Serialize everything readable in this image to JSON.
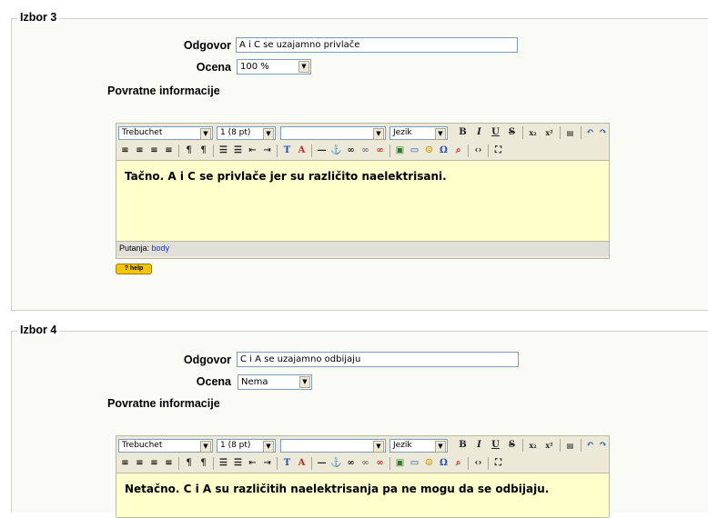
{
  "choice3": {
    "legend": "Izbor 3",
    "answer_label": "Odgovor",
    "answer_value": "A i C se uzajamno privlače",
    "grade_label": "Ocena",
    "grade_value": "100 %",
    "feedback_label": "Povratne informacije",
    "editor": {
      "font": "Trebuchet",
      "size": "1 (8 pt)",
      "style": "",
      "lang": "Jezik",
      "content": "Tačno. A i C se privlače jer su različito naelektrisani.",
      "path_label": "Putanja:",
      "path_value": "body",
      "help": "? help"
    }
  },
  "choice4": {
    "legend": "Izbor 4",
    "answer_label": "Odgovor",
    "answer_value": "C i A se uzajamno odbijaju",
    "grade_label": "Ocena",
    "grade_value": "Nema",
    "feedback_label": "Povratne informacije",
    "editor": {
      "font": "Trebuchet",
      "size": "1 (8 pt)",
      "style": "",
      "lang": "Jezik",
      "content": "Netačno. C i A su različitih naelektrisanja pa ne mogu da se odbijaju."
    }
  },
  "toolbar_icons": {
    "bold": "B",
    "italic": "I",
    "underline": "U",
    "strike": "S",
    "sub": "x₂",
    "sup": "x²",
    "undo": "↶",
    "redo": "↷",
    "align_left": "≡",
    "align_center": "≡",
    "align_right": "≡",
    "justify": "≡",
    "ltr": "¶",
    "rtl": "¶",
    "ol": "☰",
    "ul": "☰",
    "outdent": "⇤",
    "indent": "⇥",
    "forecolor": "T",
    "backcolor": "A",
    "hr": "—",
    "anchor": "⚓",
    "link": "∞",
    "unlink": "∞",
    "nolink": "∞",
    "image": "▣",
    "table": "▭",
    "smiley": "☺",
    "char": "Ω",
    "find": "⌕",
    "html": "‹›",
    "fullscreen": "⛶"
  }
}
